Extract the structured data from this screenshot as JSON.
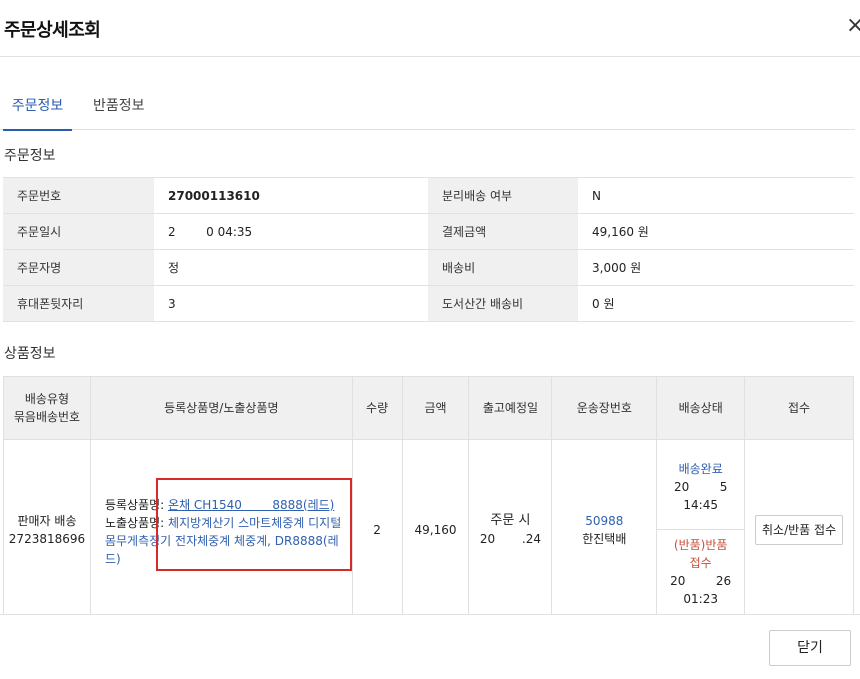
{
  "header": {
    "title": "주문상세조회",
    "close_icon": "×"
  },
  "tabs": [
    {
      "label": "주문정보"
    },
    {
      "label": "반품정보"
    }
  ],
  "order_section": {
    "title": "주문정보",
    "rows": [
      {
        "label1": "주문번호",
        "value1": "27000113610",
        "label2": "분리배송 여부",
        "value2": "N"
      },
      {
        "label1": "주문일시",
        "value1": "2        0 04:35",
        "label2": "결제금액",
        "value2": "49,160 원"
      },
      {
        "label1": "주문자명",
        "value1": "정",
        "label2": "배송비",
        "value2": "3,000 원"
      },
      {
        "label1": "휴대폰뒷자리",
        "value1": "3",
        "label2": "도서산간 배송비",
        "value2": "0 원"
      }
    ]
  },
  "product_section": {
    "title": "상품정보",
    "headers": {
      "col1_line1": "배송유형",
      "col1_line2": "묶음배송번호",
      "col2": "등록상품명/노출상품명",
      "col3": "수량",
      "col4": "금액",
      "col5": "출고예정일",
      "col6": "운송장번호",
      "col7": "배송상태",
      "col8": "접수"
    },
    "row": {
      "ship_type": "판매자 배송",
      "bundle_no": "2723818696",
      "reg_label": "등록상품명: ",
      "reg_name": "온채 CH1540        8888(레드)",
      "disp_label": "노출상품명: ",
      "disp_name": "체지방계산기 스마트체중계 디지털 몸무게측정기 전자체중계 체중계, DR8888(레드)",
      "qty": "2",
      "amount": "49,160",
      "ship_line1": "주문 시",
      "ship_line2": "20       .24",
      "tracking_no": "50988",
      "carrier": "한진택배",
      "status1_label": "배송완료",
      "status1_date": "20        5",
      "status1_time": "14:45",
      "status2_label1": "(반품)반품",
      "status2_label2": "접수",
      "status2_date": "20        26",
      "status2_time": "01:23",
      "action_label": "취소/반품 접수"
    }
  },
  "footer": {
    "close_label": "닫기"
  },
  "colors": {
    "accent": "#2a5db0",
    "highlight_box": "#d42a2a",
    "return_status": "#c8503a"
  }
}
